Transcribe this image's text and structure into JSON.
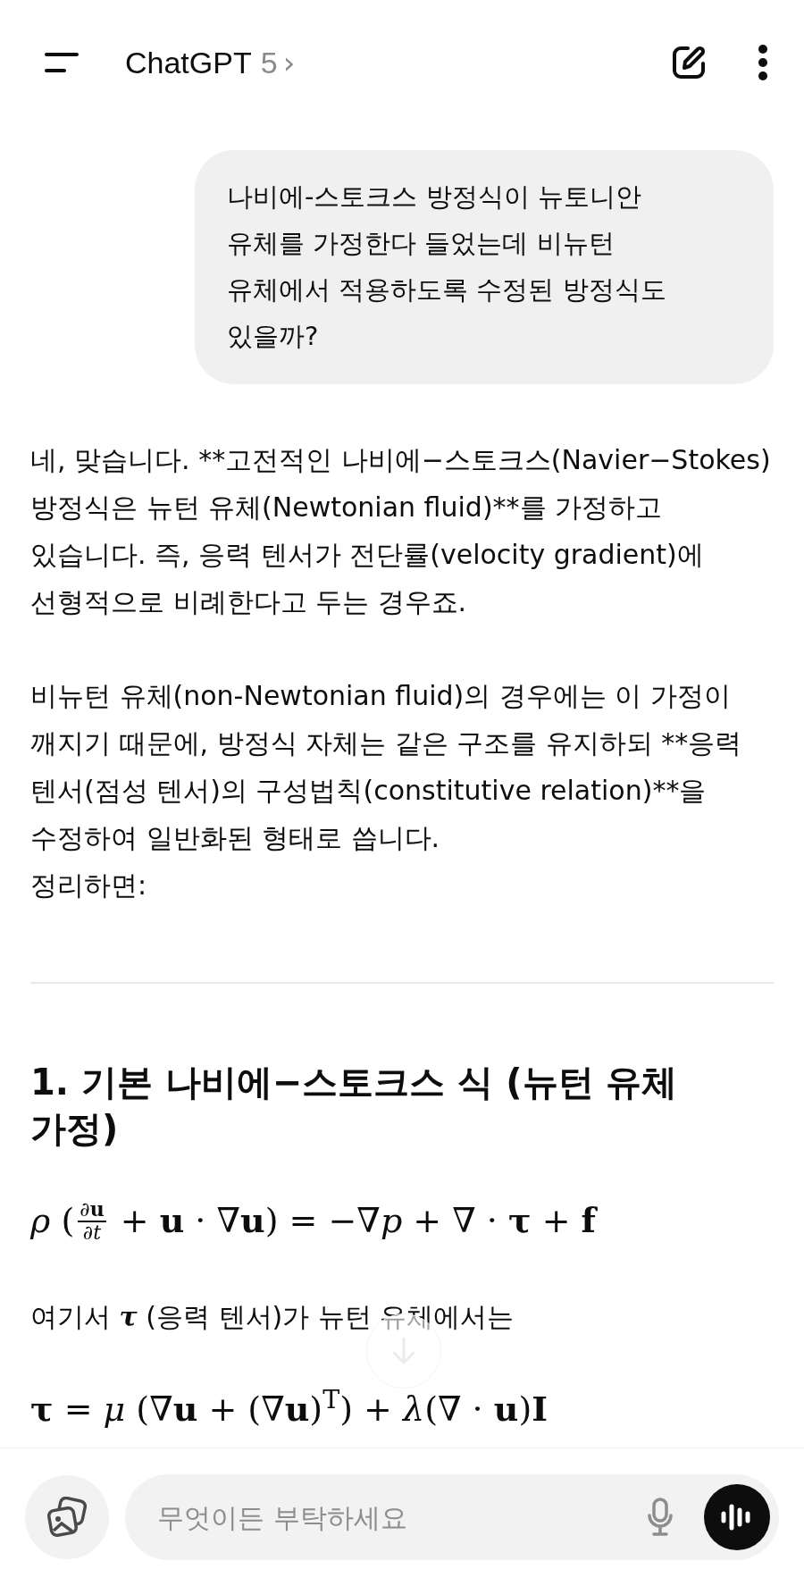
{
  "header": {
    "title": "ChatGPT",
    "model": "5",
    "chevron": "›"
  },
  "messages": [
    {
      "kind": "user",
      "text": "나비에-스토크스 방정식이 뉴토니안 유체를 가정한다 들었는데 비뉴턴 유체에서 적용하도록 수정된 방정식도 있을까?"
    },
    {
      "kind": "assistant",
      "blocks": [
        {
          "kind": "paragraph",
          "text": "네, 맞습니다. **고전적인 나비에−스토크스(Navier−Stokes) 방정식은 뉴턴 유체(Newtonian fluid)**를 가정하고 있습니다. 즉, 응력 텐서가 전단률(velocity gradient)에 선형적으로 비례한다고 두는 경우죠."
        },
        {
          "kind": "paragraph",
          "text": "비뉴턴 유체(non-Newtonian fluid)의 경우에는 이 가정이 깨지기 때문에, 방정식 자체는 같은 구조를 유지하되 **응력 텐서(점성 텐서)의 구성법칙(constitutive relation)**을 수정하여 일반화된 형태로 씁니다.\n정리하면:"
        },
        {
          "kind": "rule"
        },
        {
          "kind": "heading",
          "text": "1. 기본 나비에−스토크스 식 (뉴턴 유체 가정)"
        },
        {
          "kind": "equation",
          "segments": [
            {
              "kind": "text",
              "text": "*ρ* ("
            },
            {
              "kind": "frac",
              "num": "∂**u**",
              "den": "∂*t*"
            },
            {
              "kind": "text",
              "text": " + **u** · ∇**u**) = −∇*p* + ∇ · **τ** + **f**"
            }
          ]
        },
        {
          "kind": "richline",
          "text": "여기서 **τ** (응력 텐서)가 뉴턴 유체에서는"
        },
        {
          "kind": "equation",
          "segments": [
            {
              "kind": "text",
              "text": "**τ** = *μ* (∇**u** + (∇**u**)$^{T}$) + *λ*(∇ · **u**)**I**"
            }
          ]
        }
      ]
    }
  ],
  "composer": {
    "placeholder": "무엇이든 부탁하세요"
  }
}
